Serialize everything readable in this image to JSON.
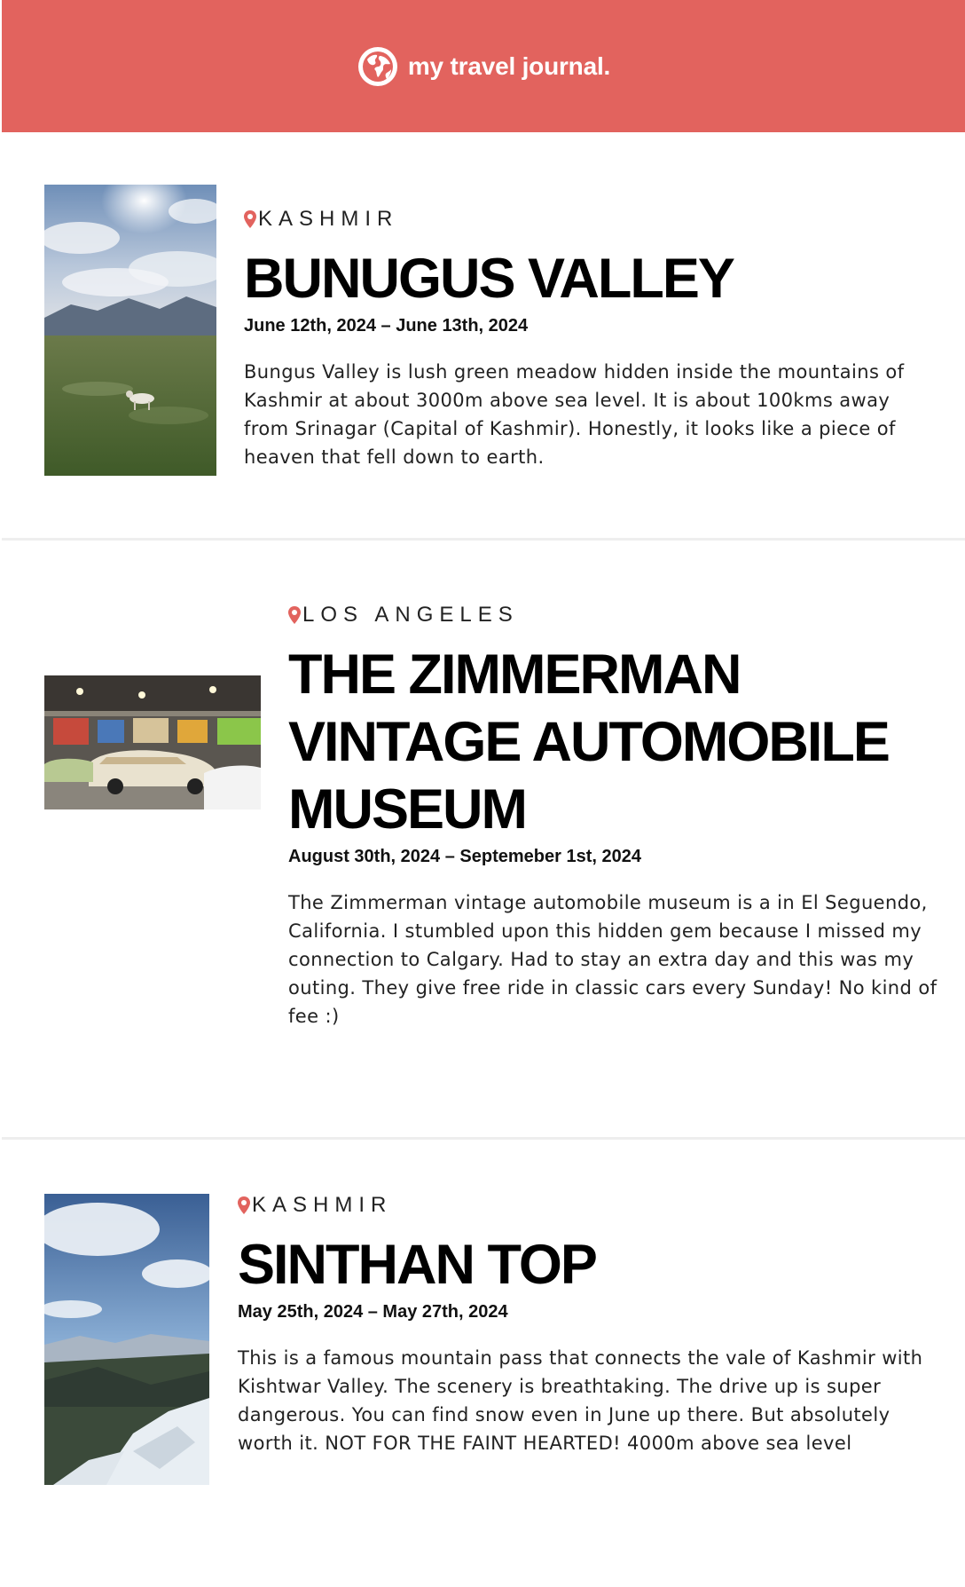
{
  "header": {
    "brand_icon": "globe-icon",
    "title": "my travel journal.",
    "background_color": "#e2635e"
  },
  "entries": [
    {
      "location": "KASHMIR",
      "title": "BUNUGUS VALLEY",
      "dates": "June 12th, 2024 – June 13th, 2024",
      "description": "Bungus Valley is lush green meadow hidden inside the mountains of Kashmir at about 3000m above sea level. It is about 100kms away from Srinagar (Capital of Kashmir). Honestly, it looks like a piece of heaven that fell down to earth."
    },
    {
      "location": "LOS ANGELES",
      "title": "THE ZIMMERMAN VINTAGE AUTOMOBILE MUSEUM",
      "dates": "August 30th, 2024 – Septemeber 1st, 2024",
      "description": "The Zimmerman vintage automobile museum is a in El Seguendo, California. I stumbled upon this hidden gem because I missed my connection to Calgary. Had to stay an extra day and this was my outing. They give free ride in classic cars every Sunday! No kind of fee :)"
    },
    {
      "location": "KASHMIR",
      "title": "SINTHAN TOP",
      "dates": "May 25th, 2024 – May 27th, 2024",
      "description": "This is a famous mountain pass that connects the vale of Kashmir with Kishtwar Valley. The scenery is breathtaking. The drive up is super dangerous. You can find snow even in June up there. But absolutely worth it. NOT FOR THE FAINT HEARTED! 4000m above sea level"
    }
  ],
  "colors": {
    "accent": "#e2635e",
    "pin": "#e2635e",
    "divider": "#eeeeee"
  }
}
